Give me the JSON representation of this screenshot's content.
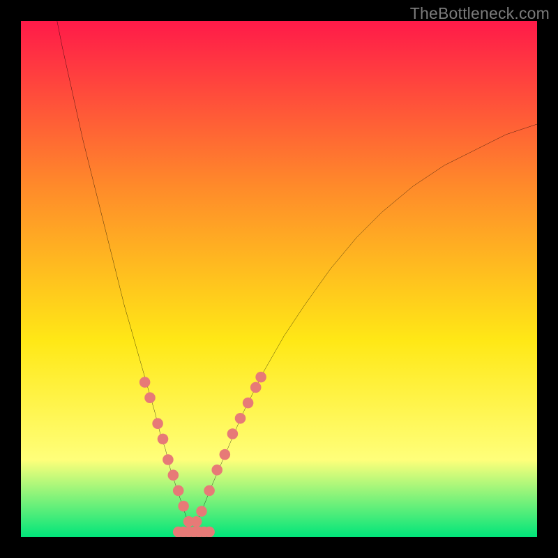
{
  "watermark": "TheBottleneck.com",
  "chart_data": {
    "type": "line",
    "title": "",
    "xlabel": "",
    "ylabel": "",
    "xlim": [
      0,
      100
    ],
    "ylim": [
      0,
      100
    ],
    "grid": false,
    "legend": false,
    "background_gradient": {
      "top": "#ff1a49",
      "upper_mid": "#ff8a2a",
      "mid": "#ffe816",
      "lower_mid": "#ffff7a",
      "bottom": "#00e57a"
    },
    "series": [
      {
        "name": "curve-left",
        "type": "line",
        "color": "#000000",
        "x": [
          7,
          8,
          10,
          12,
          14,
          16,
          18,
          20,
          22,
          24,
          26,
          27,
          28,
          29,
          30,
          31,
          32,
          33
        ],
        "y": [
          100,
          95,
          86,
          77,
          69,
          61,
          53,
          45,
          38,
          31,
          24,
          20,
          17,
          13,
          10,
          7,
          4,
          1
        ]
      },
      {
        "name": "curve-right",
        "type": "line",
        "color": "#000000",
        "x": [
          33,
          35,
          37,
          40,
          43,
          47,
          51,
          55,
          60,
          65,
          70,
          76,
          82,
          88,
          94,
          100
        ],
        "y": [
          1,
          5,
          10,
          17,
          24,
          32,
          39,
          45,
          52,
          58,
          63,
          68,
          72,
          75,
          78,
          80
        ]
      },
      {
        "name": "markers-left",
        "type": "scatter",
        "color": "#e77a77",
        "x": [
          24.0,
          25.0,
          26.5,
          27.5,
          28.5,
          29.5,
          30.5,
          31.5,
          32.5
        ],
        "y": [
          30,
          27,
          22,
          19,
          15,
          12,
          9,
          6,
          3
        ]
      },
      {
        "name": "markers-right",
        "type": "scatter",
        "color": "#e77a77",
        "x": [
          34.0,
          35.0,
          36.5,
          38.0,
          39.5,
          41.0,
          42.5,
          44.0,
          45.5,
          46.5
        ],
        "y": [
          3,
          5,
          9,
          13,
          16,
          20,
          23,
          26,
          29,
          31
        ]
      },
      {
        "name": "markers-flat",
        "type": "scatter",
        "color": "#e77a77",
        "x": [
          30.5,
          31.5,
          32.5,
          33.5,
          34.5,
          35.5,
          36.5
        ],
        "y": [
          1,
          1,
          1,
          1,
          1,
          1,
          1
        ]
      }
    ]
  }
}
